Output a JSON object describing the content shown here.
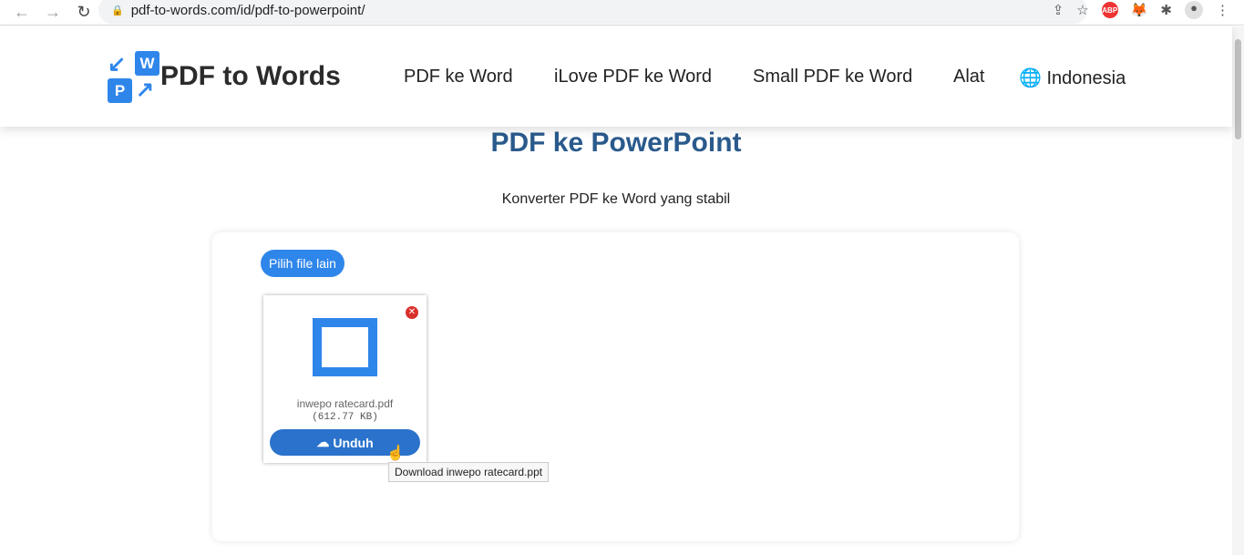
{
  "browser": {
    "url": "pdf-to-words.com/id/pdf-to-powerpoint/",
    "extensions": [
      "share-icon",
      "star-icon",
      "adblock-icon",
      "metamask-icon",
      "puzzle-icon",
      "profile-icon",
      "menu-icon"
    ],
    "abp_label": "ABP"
  },
  "header": {
    "brand": "PDF to Words",
    "logo_letters": [
      "W",
      "P"
    ],
    "nav": [
      "PDF ke Word",
      "iLove PDF ke Word",
      "Small PDF ke Word",
      "Alat"
    ],
    "language": "Indonesia"
  },
  "main": {
    "title": "PDF ke PowerPoint",
    "subtitle": "Konverter PDF ke Word yang stabil",
    "pick_button": "Pilih file lain",
    "file": {
      "name": "inwepo ratecard.pdf",
      "size": "(612.77 KB)",
      "download_label": "Unduh",
      "tooltip": "Download inwepo ratecard.ppt"
    }
  },
  "colors": {
    "accent": "#2f86ea",
    "title": "#2a5a8c",
    "close": "#d9302c"
  }
}
